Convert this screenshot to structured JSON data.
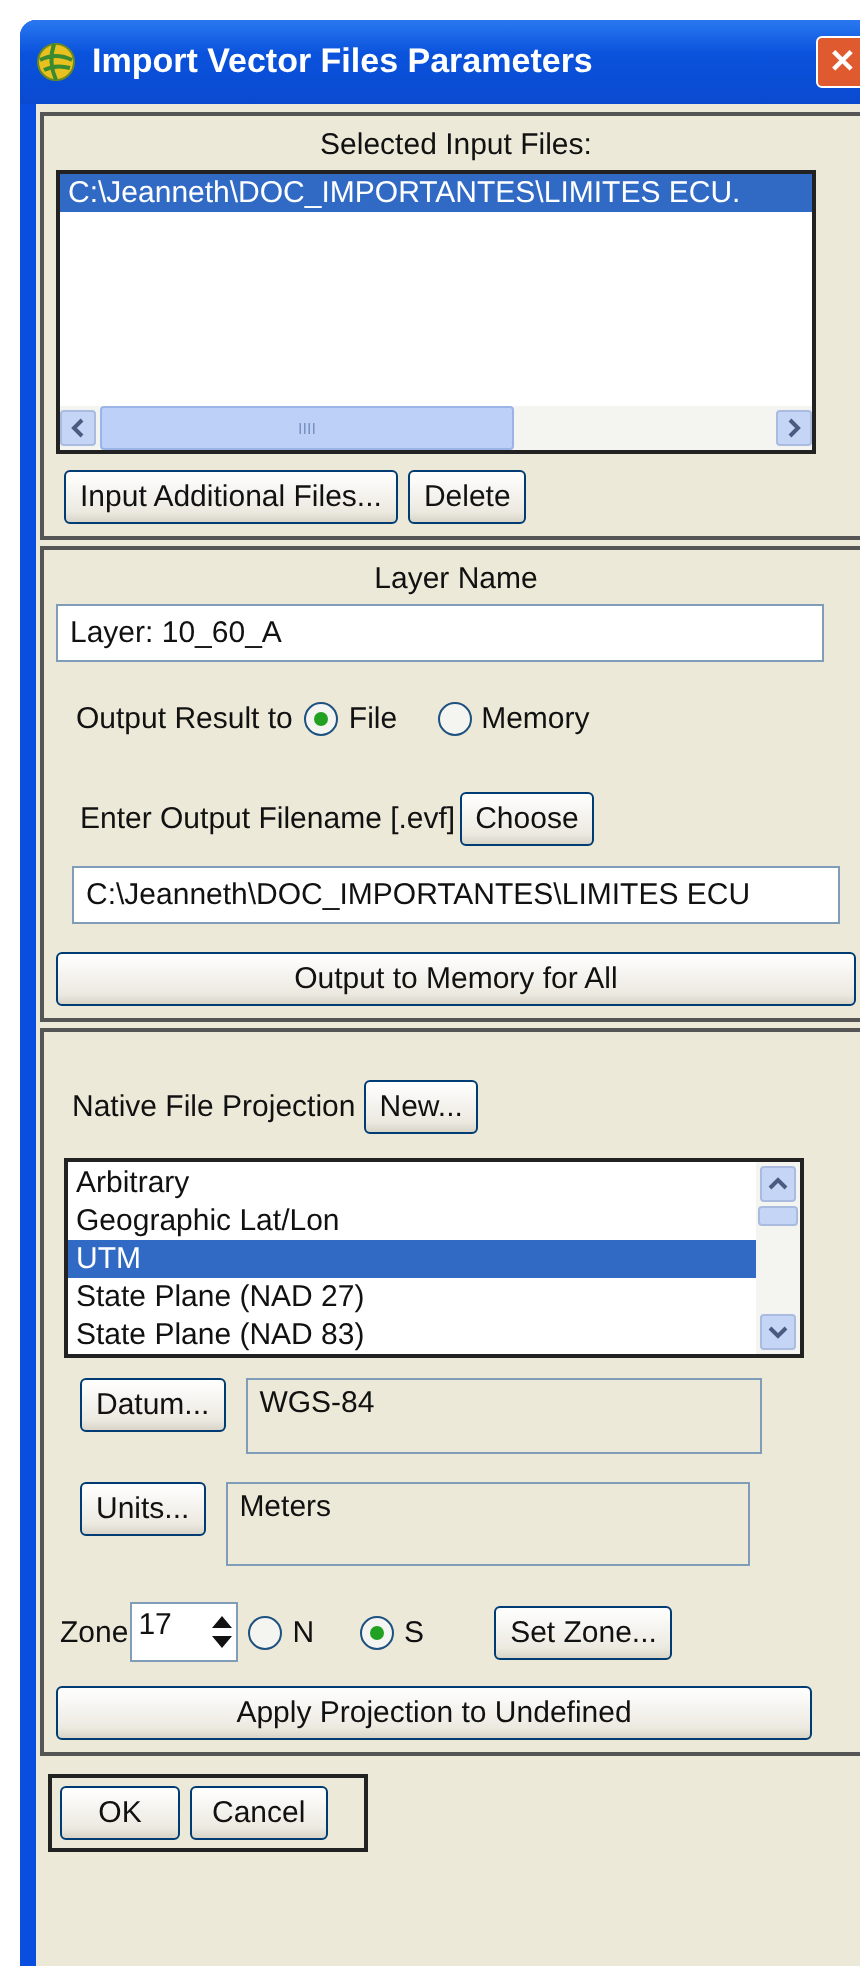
{
  "window": {
    "title": "Import Vector Files Parameters",
    "close": "✕"
  },
  "input_files": {
    "label": "Selected Input Files:",
    "items": [
      {
        "text": "C:\\Jeanneth\\DOC_IMPORTANTES\\LIMITES ECU.",
        "selected": true
      }
    ],
    "scroll_grip": "IIII",
    "buttons": [
      "Input Additional Files...",
      "Delete"
    ]
  },
  "layer": {
    "label": "Layer Name",
    "value": "Layer: 10_60_A",
    "output_label": "Output Result to",
    "output_options": [
      {
        "label": "File",
        "selected": true
      },
      {
        "label": "Memory",
        "selected": false
      }
    ],
    "filename_label": "Enter Output Filename [.evf]",
    "choose_button": "Choose",
    "filename_value": "C:\\Jeanneth\\DOC_IMPORTANTES\\LIMITES ECU",
    "memory_button": "Output to Memory for All"
  },
  "projection": {
    "label": "Native File Projection",
    "new_button": "New...",
    "items": [
      {
        "text": "Arbitrary",
        "selected": false
      },
      {
        "text": "Geographic Lat/Lon",
        "selected": false
      },
      {
        "text": "UTM",
        "selected": true
      },
      {
        "text": "State Plane (NAD 27)",
        "selected": false
      },
      {
        "text": "State Plane (NAD 83)",
        "selected": false
      }
    ],
    "datum_button": "Datum...",
    "datum_value": "WGS-84",
    "units_button": "Units...",
    "units_value": "Meters",
    "zone_label": "Zone",
    "zone_value": "17",
    "hemispheres": [
      {
        "label": "N",
        "selected": false
      },
      {
        "label": "S",
        "selected": true
      }
    ],
    "set_zone_button": "Set Zone...",
    "apply_button": "Apply Projection to Undefined"
  },
  "buttons": [
    "OK",
    "Cancel"
  ]
}
